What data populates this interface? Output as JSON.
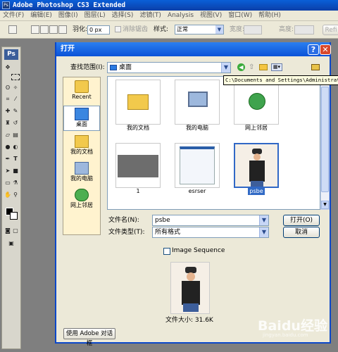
{
  "app": {
    "title": "Adobe Photoshop CS3 Extended",
    "menu": [
      "文件(F)",
      "编辑(E)",
      "图像(I)",
      "图层(L)",
      "选择(S)",
      "滤镜(T)",
      "Analysis",
      "视图(V)",
      "窗口(W)",
      "帮助(H)"
    ]
  },
  "options": {
    "feather_label": "羽化:",
    "feather_value": "0 px",
    "antialias_label": "消除锯齿",
    "style_label": "样式:",
    "style_value": "正常",
    "width_label": "宽度:",
    "height_label": "高度:",
    "refine_label": "Refi"
  },
  "toolbox": {
    "logo": "Ps"
  },
  "dialog": {
    "title": "打开",
    "look_in_label": "查找范围(I):",
    "look_in_value": "桌面",
    "tooltip": "C:\\Documents and Settings\\Administrator\\",
    "places": [
      {
        "label": "Recent",
        "icon": "recent-icon"
      },
      {
        "label": "桌面",
        "icon": "desktop-icon"
      },
      {
        "label": "我的文档",
        "icon": "my-documents-icon"
      },
      {
        "label": "我的电脑",
        "icon": "my-computer-icon"
      },
      {
        "label": "网上邻居",
        "icon": "network-icon"
      }
    ],
    "files": [
      {
        "label": "我的文档",
        "icon": "folder-icon"
      },
      {
        "label": "我的电脑",
        "icon": "computer-icon"
      },
      {
        "label": "网上邻居",
        "icon": "network-icon"
      },
      {
        "label": "1",
        "icon": "screenshot-thumbnail"
      },
      {
        "label": "esrser",
        "icon": "document-thumbnail"
      },
      {
        "label": "psbe",
        "icon": "photo-thumbnail",
        "selected": true
      }
    ],
    "filename_label": "文件名(N):",
    "filename_value": "psbe",
    "filetype_label": "文件类型(T):",
    "filetype_value": "所有格式",
    "open_button": "打开(O)",
    "cancel_button": "取消",
    "image_sequence_label": "Image Sequence",
    "file_size": "文件大小: 31.6K",
    "adobe_dialog_button": "使用 Adobe 对话框"
  },
  "watermark": {
    "brand": "Baidu经验",
    "url": "jingyan.baidu.com"
  },
  "colors": {
    "titlebar": "#0b47c9",
    "dialog_bg": "#ece9d8",
    "selection": "#316ac5"
  }
}
